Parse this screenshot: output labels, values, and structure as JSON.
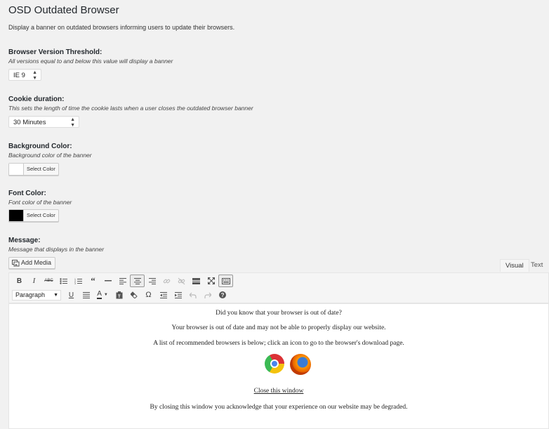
{
  "page": {
    "title": "OSD Outdated Browser",
    "description": "Display a banner on outdated browsers informing users to update their browsers."
  },
  "fields": {
    "threshold": {
      "label": "Browser Version Threshold:",
      "help": "All versions equal to and below this value will display a banner",
      "value": "IE 9"
    },
    "cookie": {
      "label": "Cookie duration:",
      "help": "This sets the length of time the cookie lasts when a user closes the outdated browser banner",
      "value": "30 Minutes"
    },
    "bg_color": {
      "label": "Background Color:",
      "help": "Background color of the banner",
      "button": "Select Color",
      "swatch": "#ffffff"
    },
    "font_color": {
      "label": "Font Color:",
      "help": "Font color of the banner",
      "button": "Select Color",
      "swatch": "#000000"
    },
    "message": {
      "label": "Message:",
      "help": "Message that displays in the banner"
    }
  },
  "editor": {
    "add_media": "Add Media",
    "tab_visual": "Visual",
    "tab_text": "Text",
    "format_value": "Paragraph",
    "toolbar_row1": [
      "bold-icon",
      "italic-icon",
      "strikethrough-icon",
      "bullet-list-icon",
      "numbered-list-icon",
      "blockquote-icon",
      "horizontal-line-icon",
      "align-left-icon",
      "align-center-icon",
      "align-right-icon",
      "link-icon",
      "unlink-icon",
      "read-more-icon",
      "fullscreen-icon",
      "toolbar-toggle-icon"
    ],
    "toolbar_row2": [
      "underline-icon",
      "justify-icon",
      "text-color-icon",
      "paste-text-icon",
      "clear-formatting-icon",
      "special-character-icon",
      "outdent-icon",
      "indent-icon",
      "undo-icon",
      "redo-icon",
      "help-icon"
    ],
    "content": {
      "line1": "Did you know that your browser is out of date?",
      "line2": "Your browser is out of date and may not be able to properly display our website.",
      "line3": "A list of recommended browsers is below; click an icon to go to the browser's download page.",
      "close_link": "Close this window",
      "line4": "By closing this window you acknowledge that your experience on our website may be degraded."
    }
  }
}
